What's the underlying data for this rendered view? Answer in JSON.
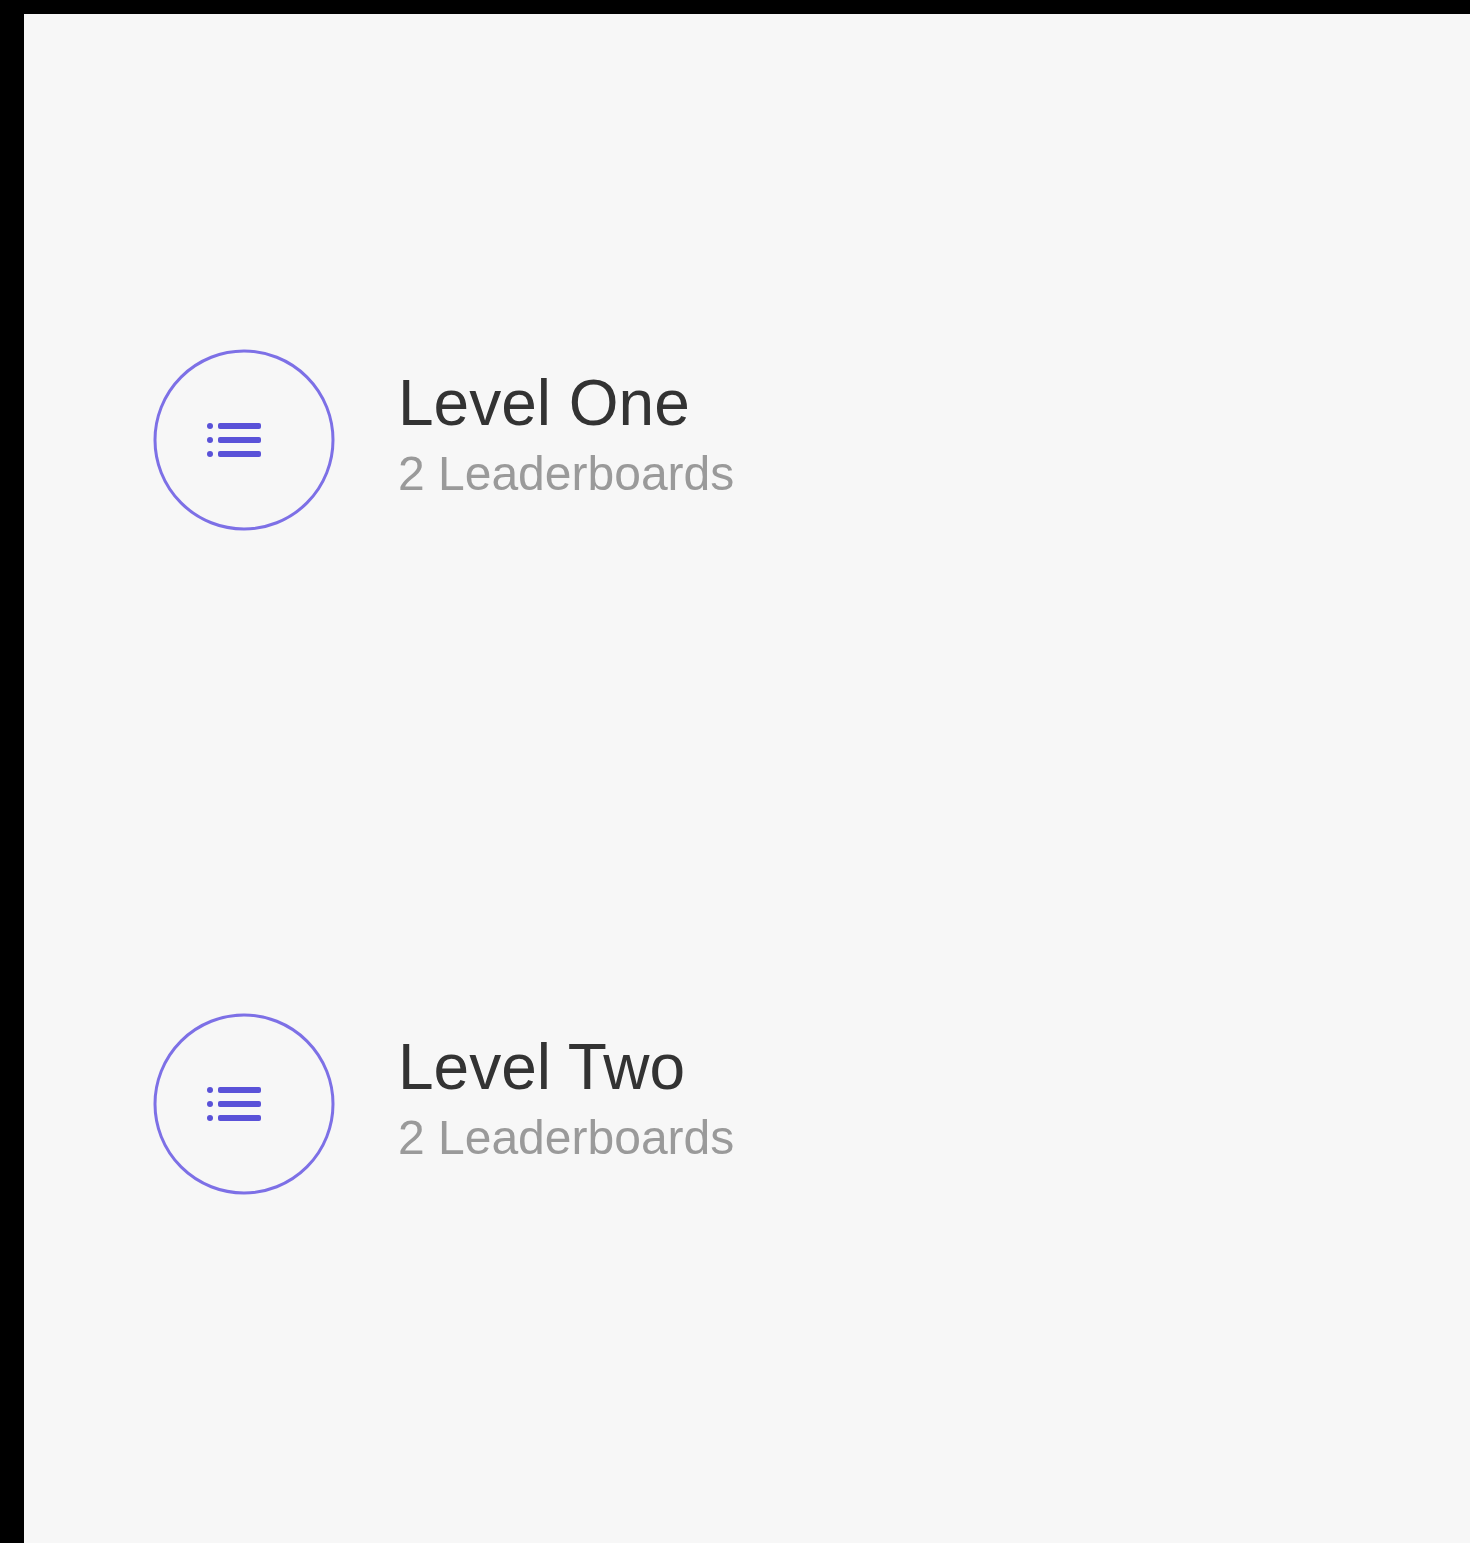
{
  "levels": [
    {
      "title": "Level One",
      "subtitle": "2 Leaderboards"
    },
    {
      "title": "Level Two",
      "subtitle": "2 Leaderboards"
    }
  ]
}
